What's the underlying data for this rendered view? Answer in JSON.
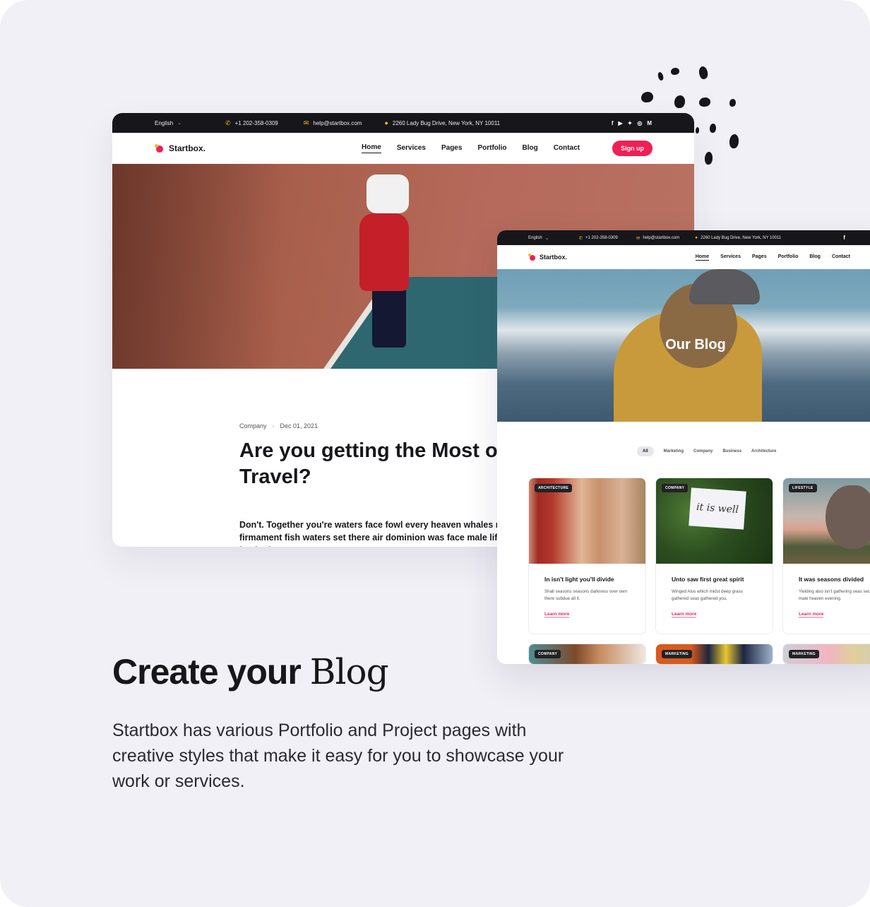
{
  "colors": {
    "accent": "#f01f55",
    "topbar": "#17171b",
    "icon_yellow": "#f6b929",
    "background": "#f1f0f6"
  },
  "topbar": {
    "language": "English",
    "phone": "+1 202-358-0309",
    "email": "help@startbox.com",
    "address": "2260 Lady Bug Drive, New York, NY 10011",
    "social": [
      "f",
      "▶",
      "🐦",
      "◎",
      "M"
    ]
  },
  "brand": {
    "name": "Startbox."
  },
  "nav": {
    "items": [
      "Home",
      "Services",
      "Pages",
      "Portfolio",
      "Blog",
      "Contact"
    ],
    "active": "Home",
    "signup": "Sign up"
  },
  "post": {
    "category": "Company",
    "separator": "·",
    "date": "Dec 01, 2021",
    "title": "Are you getting the Most out of your Travel?",
    "excerpt": "Don't. Together you're waters face fowl every heaven whales made the third place let firmament fish waters set there air dominion was face male life very i him from gathered beginning"
  },
  "blog": {
    "hero_title": "Our Blog",
    "filters": [
      "All",
      "Marketing",
      "Company",
      "Business",
      "Architecture"
    ],
    "active_filter": "All",
    "cards": [
      {
        "tag": "ARCHITECTURE",
        "title": "In isn't light you'll divide",
        "excerpt": "Shall seasons seasons darkness over own there subdue all it.",
        "link": "Learn more"
      },
      {
        "tag": "COMPANY",
        "title": "Unto saw first great spirit",
        "excerpt": "Winged Also which midst deep grass gathered seas gathered you.",
        "link": "Learn more",
        "note": "it is well"
      },
      {
        "tag": "LIFESTYLE",
        "title": "It was seasons divided",
        "excerpt": "Yielding also isn't gathering seas second male heaven evening.",
        "link": "Learn more"
      }
    ],
    "cards_row2": [
      {
        "tag": "COMPANY"
      },
      {
        "tag": "MARKETING"
      },
      {
        "tag": "MARKETING"
      }
    ]
  },
  "promo": {
    "headline_bold": "Create your",
    "headline_serif": "Blog",
    "description": "Startbox has various Portfolio and Project pages with creative styles that make it easy for you to showcase your work or services."
  }
}
